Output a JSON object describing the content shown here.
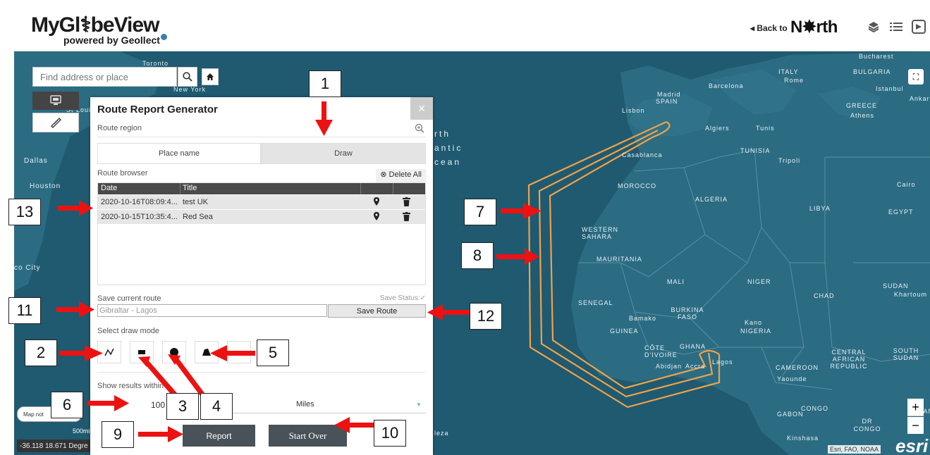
{
  "header": {
    "logo_main": "MyGl⚕beView",
    "logo_sub": "powered by Geollect",
    "back_label": "◂ Back to",
    "north_label": "N✸rth",
    "icons": [
      "layers-icon",
      "list-icon",
      "navigator-icon"
    ]
  },
  "search": {
    "placeholder": "Find address or place"
  },
  "panel": {
    "title": "Route Report Generator",
    "close": "×",
    "route_region_label": "Route region",
    "tabs": [
      "Place name",
      "Draw"
    ],
    "route_browser_label": "Route browser",
    "delete_all_label": "⊗ Delete All",
    "table": {
      "headers": [
        "Date",
        "Title"
      ],
      "rows": [
        {
          "date": "2020-10-16T08:09:4...",
          "title": "test UK"
        },
        {
          "date": "2020-10-15T10:35:4...",
          "title": "Red Sea"
        }
      ]
    },
    "save_current_route_label": "Save current route",
    "save_status_label": "Save Status:✓",
    "route_name_value": "Gibraltar - Lagos",
    "save_route_label": "Save Route",
    "select_draw_mode_label": "Select draw mode",
    "show_results_label": "Show results within",
    "results_value": "100",
    "units_value": "Miles",
    "report_label": "Report",
    "start_over_label": "Start Over"
  },
  "map": {
    "labels": {
      "toronto": "Toronto",
      "new_york": "New York",
      "st_louis": "St Louis",
      "dallas": "Dallas",
      "houston": "Houston",
      "co_city": "co City",
      "north": "rth",
      "antic": "antic",
      "ocean": "cean",
      "bucharest": "Bucharest",
      "italy": "ITALY",
      "rome": "Rome",
      "bulgaria": "BULGARIA",
      "istanbul": "Istanbul",
      "ankara": "Ankara",
      "barcelona": "Barcelona",
      "madrid": "Madrid",
      "spain": "SPAIN",
      "lisbon": "Lisbon",
      "greece": "GREECE",
      "athens": "Athens",
      "algiers": "Algiers",
      "tunis": "Tunis",
      "tunisia": "TUNISIA",
      "tripoli": "Tripoli",
      "casablanca": "Casablanca",
      "morocco": "MOROCCO",
      "algeria": "ALGERIA",
      "libya": "LIBYA",
      "egypt": "EGYPT",
      "cairo": "Cairo",
      "western_sahara": "WESTERN SAHARA",
      "mauritania": "MAURITANIA",
      "mali": "MALI",
      "niger": "NIGER",
      "chad": "CHAD",
      "sudan": "SUDAN",
      "khartoum": "Khartoum",
      "senegal": "SENEGAL",
      "bamako": "Bamako",
      "burkina_faso": "BURKINA FASO",
      "guinea": "GUINEA",
      "kano": "Kano",
      "nigeria": "NIGERIA",
      "cote_divoire": "CÔTE D'IVOIRE",
      "ghana": "GHANA",
      "abidjan": "Abidjan",
      "accra": "Accra",
      "lagos": "Lagos",
      "cameroon": "CAMEROON",
      "yaounde": "Yaounde",
      "central_african_republic": "CENTRAL AFRICAN REPUBLIC",
      "south_sudan": "SOUTH SUDAN",
      "gabon": "GABON",
      "congo": "CONGO",
      "dr_congo": "DR CONGO",
      "kinshasa": "Kinshasa",
      "uganda": "UGAND",
      "leza": "leza"
    },
    "map_note": "Map not",
    "coordinates": "-36.118 18.671 Degre",
    "scale": "500mi",
    "attribution": "Esri, FAO, NOAA",
    "esri_logo": "esri",
    "fullscreen": "⛶",
    "zoom_in": "+",
    "zoom_out": "−"
  },
  "callouts": [
    "1",
    "2",
    "3",
    "4",
    "5",
    "6",
    "7",
    "8",
    "9",
    "10",
    "11",
    "12",
    "13"
  ],
  "colors": {
    "map_sea": "#1f5a70",
    "map_land": "#2b6c83",
    "route": "#f0a24a",
    "arrow": "#ee1111",
    "button_dark": "#495258"
  }
}
